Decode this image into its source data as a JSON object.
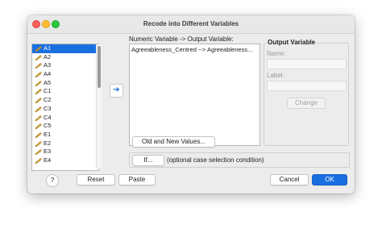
{
  "window": {
    "title": "Recode into Different Variables"
  },
  "variables": [
    {
      "name": "A1"
    },
    {
      "name": "A2"
    },
    {
      "name": "A3"
    },
    {
      "name": "A4"
    },
    {
      "name": "A5"
    },
    {
      "name": "C1"
    },
    {
      "name": "C2"
    },
    {
      "name": "C3"
    },
    {
      "name": "C4"
    },
    {
      "name": "C5"
    },
    {
      "name": "E1"
    },
    {
      "name": "E2"
    },
    {
      "name": "E3"
    },
    {
      "name": "E4"
    }
  ],
  "selected_variable": "A1",
  "variable_icon": "ruler-scale-icon",
  "move_button": {
    "icon": "arrow-right-icon",
    "glyph": "➔"
  },
  "numeric_variable": {
    "label": "Numeric Variable -> Output Variable:",
    "rows": [
      "Agreeableness_Centred --> Agreeableness..."
    ]
  },
  "output_variable": {
    "legend": "Output Variable",
    "name_label": "Name:",
    "name_value": "",
    "label_label": "Label:",
    "label_value": "",
    "change_button": "Change"
  },
  "old_new_button": "Old and New Values...",
  "if_button": "If...",
  "if_text": "(optional case selection condition)",
  "buttons": {
    "help": "?",
    "reset": "Reset",
    "paste": "Paste",
    "cancel": "Cancel",
    "ok": "OK"
  },
  "colors": {
    "accent": "#1a6fe0",
    "close": "#fe5f57",
    "minimize": "#febc2e",
    "maximize": "#28c840"
  }
}
